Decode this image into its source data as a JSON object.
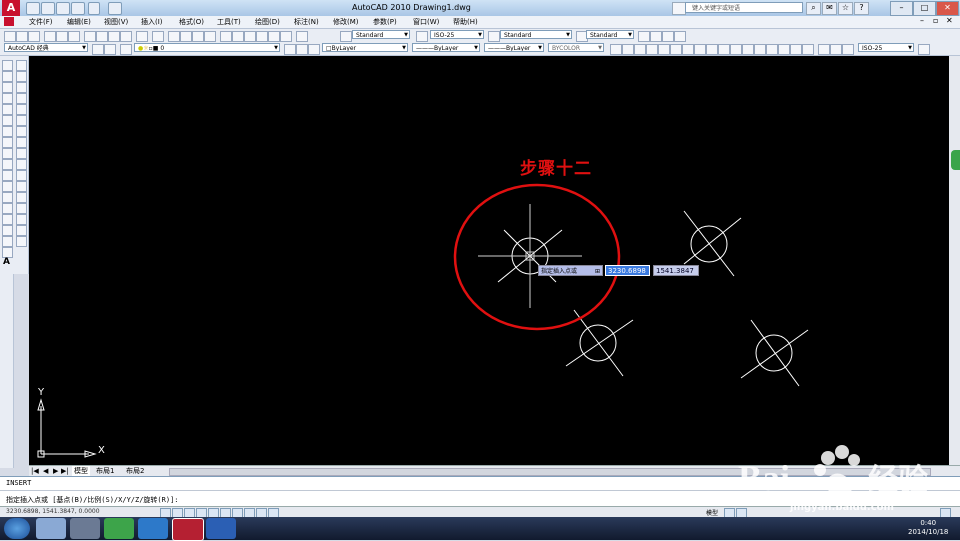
{
  "window": {
    "title": "AutoCAD 2010     Drawing1.dwg",
    "search_placeholder": "键入关键字或短语"
  },
  "menu": [
    "文件(F)",
    "编辑(E)",
    "视图(V)",
    "插入(I)",
    "格式(O)",
    "工具(T)",
    "绘图(D)",
    "标注(N)",
    "修改(M)",
    "参数(P)",
    "窗口(W)",
    "帮助(H)"
  ],
  "styles_toolbar": {
    "text_style": "Standard",
    "dim_style": "ISO-25",
    "table_style": "Standard",
    "multileader_style": "Standard"
  },
  "workspace_toolbar": {
    "workspace": "AutoCAD 经典",
    "layer": "0",
    "color": "ByLayer",
    "linetype": "ByLayer",
    "lineweight": "ByLayer",
    "plot_style": "BYCOLOR",
    "dim_style_right": "ISO-25"
  },
  "canvas": {
    "annotation": "步骤十二",
    "dynamic_input": {
      "prompt": "指定插入点或",
      "x_value": "3230.6898",
      "y_value": "1541.3847"
    },
    "ucs": {
      "x_label": "X",
      "y_label": "Y"
    }
  },
  "layout_tabs": [
    "模型",
    "布局1",
    "布局2"
  ],
  "command": {
    "history": "INSERT",
    "prompt": "指定插入点或 [基点(B)/比例(S)/X/Y/Z/旋转(R)]:"
  },
  "status": {
    "coordinates": "3230.6898, 1541.3847, 0.0000",
    "model_label": "模型"
  },
  "taskbar": {
    "time": "0:40",
    "date": "2014/10/18"
  },
  "watermark": {
    "text": "jingyan.baidu.com"
  }
}
